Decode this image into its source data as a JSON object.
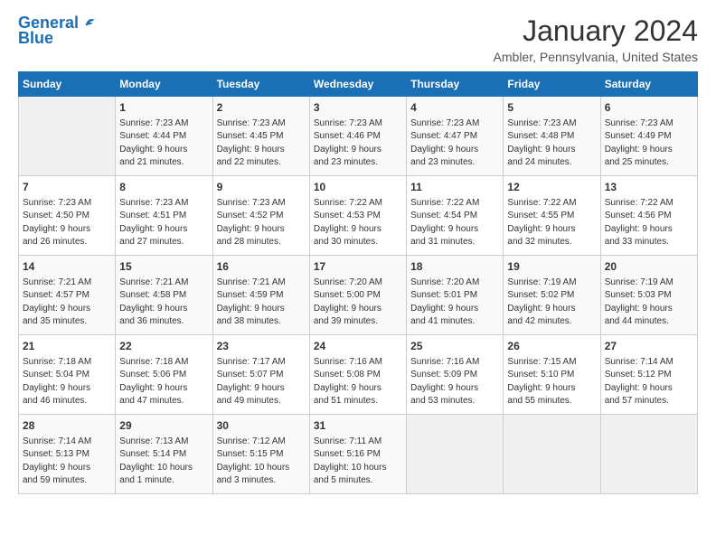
{
  "logo": {
    "line1": "General",
    "line2": "Blue"
  },
  "title": "January 2024",
  "subtitle": "Ambler, Pennsylvania, United States",
  "days_of_week": [
    "Sunday",
    "Monday",
    "Tuesday",
    "Wednesday",
    "Thursday",
    "Friday",
    "Saturday"
  ],
  "weeks": [
    [
      {
        "num": "",
        "info": ""
      },
      {
        "num": "1",
        "info": "Sunrise: 7:23 AM\nSunset: 4:44 PM\nDaylight: 9 hours\nand 21 minutes."
      },
      {
        "num": "2",
        "info": "Sunrise: 7:23 AM\nSunset: 4:45 PM\nDaylight: 9 hours\nand 22 minutes."
      },
      {
        "num": "3",
        "info": "Sunrise: 7:23 AM\nSunset: 4:46 PM\nDaylight: 9 hours\nand 23 minutes."
      },
      {
        "num": "4",
        "info": "Sunrise: 7:23 AM\nSunset: 4:47 PM\nDaylight: 9 hours\nand 23 minutes."
      },
      {
        "num": "5",
        "info": "Sunrise: 7:23 AM\nSunset: 4:48 PM\nDaylight: 9 hours\nand 24 minutes."
      },
      {
        "num": "6",
        "info": "Sunrise: 7:23 AM\nSunset: 4:49 PM\nDaylight: 9 hours\nand 25 minutes."
      }
    ],
    [
      {
        "num": "7",
        "info": "Sunrise: 7:23 AM\nSunset: 4:50 PM\nDaylight: 9 hours\nand 26 minutes."
      },
      {
        "num": "8",
        "info": "Sunrise: 7:23 AM\nSunset: 4:51 PM\nDaylight: 9 hours\nand 27 minutes."
      },
      {
        "num": "9",
        "info": "Sunrise: 7:23 AM\nSunset: 4:52 PM\nDaylight: 9 hours\nand 28 minutes."
      },
      {
        "num": "10",
        "info": "Sunrise: 7:22 AM\nSunset: 4:53 PM\nDaylight: 9 hours\nand 30 minutes."
      },
      {
        "num": "11",
        "info": "Sunrise: 7:22 AM\nSunset: 4:54 PM\nDaylight: 9 hours\nand 31 minutes."
      },
      {
        "num": "12",
        "info": "Sunrise: 7:22 AM\nSunset: 4:55 PM\nDaylight: 9 hours\nand 32 minutes."
      },
      {
        "num": "13",
        "info": "Sunrise: 7:22 AM\nSunset: 4:56 PM\nDaylight: 9 hours\nand 33 minutes."
      }
    ],
    [
      {
        "num": "14",
        "info": "Sunrise: 7:21 AM\nSunset: 4:57 PM\nDaylight: 9 hours\nand 35 minutes."
      },
      {
        "num": "15",
        "info": "Sunrise: 7:21 AM\nSunset: 4:58 PM\nDaylight: 9 hours\nand 36 minutes."
      },
      {
        "num": "16",
        "info": "Sunrise: 7:21 AM\nSunset: 4:59 PM\nDaylight: 9 hours\nand 38 minutes."
      },
      {
        "num": "17",
        "info": "Sunrise: 7:20 AM\nSunset: 5:00 PM\nDaylight: 9 hours\nand 39 minutes."
      },
      {
        "num": "18",
        "info": "Sunrise: 7:20 AM\nSunset: 5:01 PM\nDaylight: 9 hours\nand 41 minutes."
      },
      {
        "num": "19",
        "info": "Sunrise: 7:19 AM\nSunset: 5:02 PM\nDaylight: 9 hours\nand 42 minutes."
      },
      {
        "num": "20",
        "info": "Sunrise: 7:19 AM\nSunset: 5:03 PM\nDaylight: 9 hours\nand 44 minutes."
      }
    ],
    [
      {
        "num": "21",
        "info": "Sunrise: 7:18 AM\nSunset: 5:04 PM\nDaylight: 9 hours\nand 46 minutes."
      },
      {
        "num": "22",
        "info": "Sunrise: 7:18 AM\nSunset: 5:06 PM\nDaylight: 9 hours\nand 47 minutes."
      },
      {
        "num": "23",
        "info": "Sunrise: 7:17 AM\nSunset: 5:07 PM\nDaylight: 9 hours\nand 49 minutes."
      },
      {
        "num": "24",
        "info": "Sunrise: 7:16 AM\nSunset: 5:08 PM\nDaylight: 9 hours\nand 51 minutes."
      },
      {
        "num": "25",
        "info": "Sunrise: 7:16 AM\nSunset: 5:09 PM\nDaylight: 9 hours\nand 53 minutes."
      },
      {
        "num": "26",
        "info": "Sunrise: 7:15 AM\nSunset: 5:10 PM\nDaylight: 9 hours\nand 55 minutes."
      },
      {
        "num": "27",
        "info": "Sunrise: 7:14 AM\nSunset: 5:12 PM\nDaylight: 9 hours\nand 57 minutes."
      }
    ],
    [
      {
        "num": "28",
        "info": "Sunrise: 7:14 AM\nSunset: 5:13 PM\nDaylight: 9 hours\nand 59 minutes."
      },
      {
        "num": "29",
        "info": "Sunrise: 7:13 AM\nSunset: 5:14 PM\nDaylight: 10 hours\nand 1 minute."
      },
      {
        "num": "30",
        "info": "Sunrise: 7:12 AM\nSunset: 5:15 PM\nDaylight: 10 hours\nand 3 minutes."
      },
      {
        "num": "31",
        "info": "Sunrise: 7:11 AM\nSunset: 5:16 PM\nDaylight: 10 hours\nand 5 minutes."
      },
      {
        "num": "",
        "info": ""
      },
      {
        "num": "",
        "info": ""
      },
      {
        "num": "",
        "info": ""
      }
    ]
  ]
}
